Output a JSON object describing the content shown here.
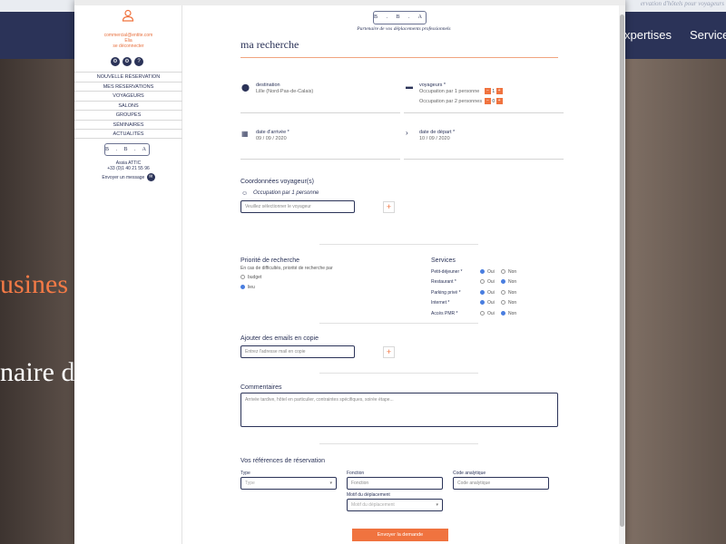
{
  "background": {
    "topbar_text": "ervation d'hôtels pour voyageurs",
    "nav_items": [
      "xpertises",
      "Service"
    ],
    "hero_line1": "usines",
    "hero_line2": "naire d"
  },
  "sidebar": {
    "email": "commercial@entite.com",
    "name": "Elia",
    "logout": "se déconnecter",
    "icons": [
      "gear-icon",
      "settings-icon",
      "help-icon"
    ],
    "icon_glyphs": [
      "⚙",
      "⚙",
      "?"
    ],
    "menu": [
      "NOUVELLE RÉSERVATION",
      "MES RÉSERVATIONS",
      "VOYAGEURS",
      "SALONS",
      "GROUPES",
      "SÉMINAIRES",
      "ACTUALITÉS"
    ],
    "logo": "B . B . A",
    "contact_name": "Assia ATTIC",
    "contact_phone": "+33 (0)1 40 21 55 96",
    "contact_message": "Envoyer un message"
  },
  "header": {
    "logo": "B . B . A",
    "tagline": "Partenaire de vos déplacements professionnels"
  },
  "search": {
    "title": "ma recherche",
    "destination_label": "destination",
    "destination_value": "Lille (Nord-Pas-de-Calais)",
    "travelers_label": "voyageurs *",
    "occ1_label": "Occupation par 1 personne",
    "occ1_value": "1",
    "occ2_label": "Occupation par 2 personnes",
    "occ2_value": "0",
    "arrival_label": "date d'arrivée *",
    "arrival_value": "09 / 09 / 2020",
    "departure_label": "date de départ *",
    "departure_value": "10 / 09 / 2020"
  },
  "travelers": {
    "title": "Coordonnées voyageur(s)",
    "occupation": "Occupation par 1 personne",
    "select_placeholder": "Veuillez sélectionner le voyageur"
  },
  "priority": {
    "title": "Priorité de recherche",
    "subtitle": "En cas de difficultés, priorité de recherche par",
    "options": [
      "budget",
      "lieu"
    ],
    "selected": 1
  },
  "services": {
    "title": "Services",
    "yes": "Oui",
    "no": "Non",
    "items": [
      {
        "label": "Petit-déjeuner *",
        "selected": "yes"
      },
      {
        "label": "Restaurant *",
        "selected": "no"
      },
      {
        "label": "Parking privé *",
        "selected": "yes"
      },
      {
        "label": "Internet *",
        "selected": "yes"
      },
      {
        "label": "Accès PMR *",
        "selected": "no"
      }
    ]
  },
  "cc": {
    "title": "Ajouter des emails en copie",
    "placeholder": "Entrez l'adresse mail en copie"
  },
  "comments": {
    "title": "Commentaires",
    "placeholder": "Arrivée tardive, hôtel en particulier, contraintes spécifiques, soirée étape..."
  },
  "references": {
    "title": "Vos références de réservation",
    "type_label": "Type",
    "type_placeholder": "Type",
    "function_label": "Fonction",
    "function_placeholder": "Fonction",
    "code_label": "Code analytique",
    "code_placeholder": "Code analytique",
    "motive_label": "Motif du déplacement",
    "motive_placeholder": "Motif du déplacement"
  },
  "submit_label": "Envoyer la demande",
  "colors": {
    "navy": "#2b3358",
    "orange": "#f0733f",
    "radio_blue": "#4a7ee0"
  }
}
